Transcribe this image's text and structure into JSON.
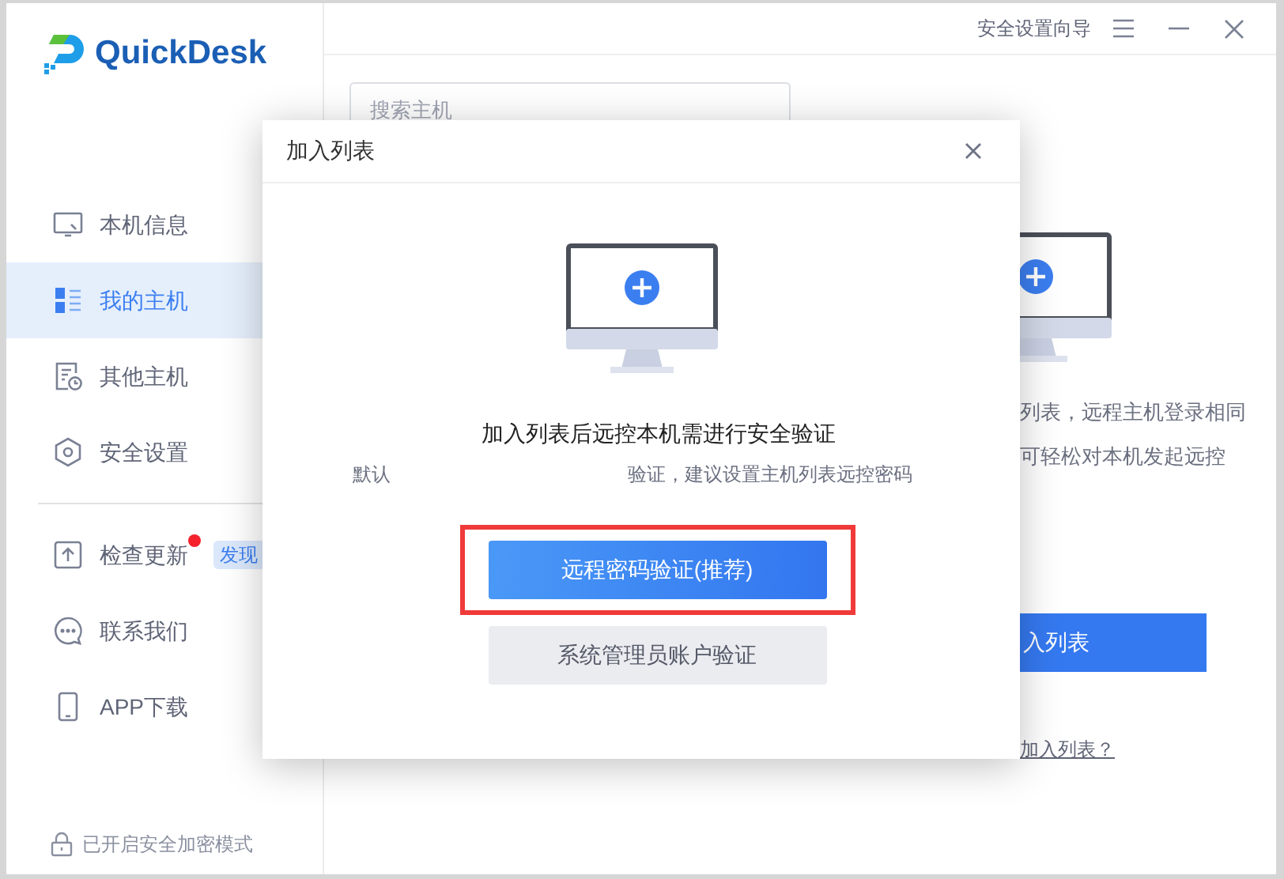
{
  "app": {
    "logo_text": "QuickDesk"
  },
  "title_bar": {
    "wizard_link": "安全设置向导"
  },
  "sidebar": {
    "items": [
      {
        "label": "本机信息",
        "selected": false
      },
      {
        "label": "我的主机",
        "selected": true
      },
      {
        "label": "其他主机",
        "selected": false
      },
      {
        "label": "安全设置",
        "selected": false
      },
      {
        "label": "检查更新",
        "selected": false,
        "dot": true,
        "badge": "发现"
      },
      {
        "label": "联系我们",
        "selected": false
      },
      {
        "label": "APP下载",
        "selected": false
      }
    ],
    "footer": "已开启安全加密模式"
  },
  "main": {
    "search": {
      "placeholder": "搜索主机"
    },
    "description_lines": [
      "列表，远程主机登录相同",
      "可轻松对本机发起远控"
    ],
    "add_button": "入列表",
    "help_link": "加入列表？"
  },
  "dialog": {
    "title": "加入列表",
    "heading": "加入列表后远控本机需进行安全验证",
    "subtitle_parts": [
      "默认",
      "验证，建议设置主机列表远控密码"
    ],
    "buttons": [
      {
        "label": "远程密码验证(推荐)",
        "kind": "primary",
        "highlighted": true
      },
      {
        "label": "系统管理员账户验证",
        "kind": "secondary",
        "highlighted": false
      }
    ]
  }
}
